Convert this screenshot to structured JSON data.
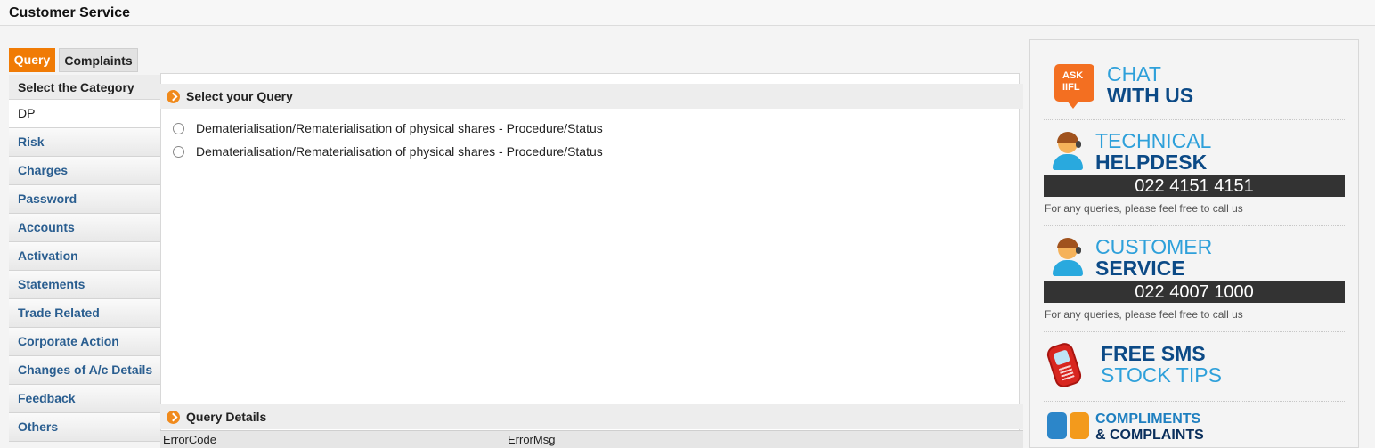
{
  "page": {
    "title": "Customer Service"
  },
  "tabs": [
    {
      "label": "Query",
      "active": true
    },
    {
      "label": "Complaints",
      "active": false
    }
  ],
  "sidebar": {
    "header": "Select the Category",
    "items": [
      {
        "label": "DP",
        "active": true
      },
      {
        "label": "Risk"
      },
      {
        "label": "Charges"
      },
      {
        "label": "Password"
      },
      {
        "label": "Accounts"
      },
      {
        "label": "Activation"
      },
      {
        "label": "Statements"
      },
      {
        "label": "Trade Related"
      },
      {
        "label": "Corporate Action"
      },
      {
        "label": "Changes of A/c Details"
      },
      {
        "label": "Feedback"
      },
      {
        "label": "Others"
      }
    ]
  },
  "query": {
    "heading": "Select your Query",
    "options": [
      "Dematerialisation/Rematerialisation of physical shares - Procedure/Status",
      "Dematerialisation/Rematerialisation of physical shares - Procedure/Status"
    ]
  },
  "details": {
    "heading": "Query Details",
    "columns": [
      "ErrorCode",
      "ErrorMsg"
    ]
  },
  "right_panel": {
    "chat": {
      "badge_line1": "ASK",
      "badge_line2": "IIFL",
      "line1": "CHAT",
      "line2": "WITH US"
    },
    "helpdesk": {
      "line1": "TECHNICAL",
      "line2": "HELPDESK",
      "phone": "022 4151 4151",
      "hint": "For any queries, please feel free to call us"
    },
    "service": {
      "line1": "CUSTOMER",
      "line2": "SERVICE",
      "phone": "022 4007 1000",
      "hint": "For any queries, please feel free to call us"
    },
    "sms": {
      "line1": "FREE SMS",
      "line2": "STOCK TIPS"
    },
    "compliments": {
      "line1": "COMPLIMENTS",
      "line2": "& COMPLAINTS"
    }
  },
  "colors": {
    "accent_orange": "#f07b05",
    "link_blue": "#2a5e90",
    "light_blue": "#2ea0da",
    "dark_blue": "#0c4a86"
  }
}
